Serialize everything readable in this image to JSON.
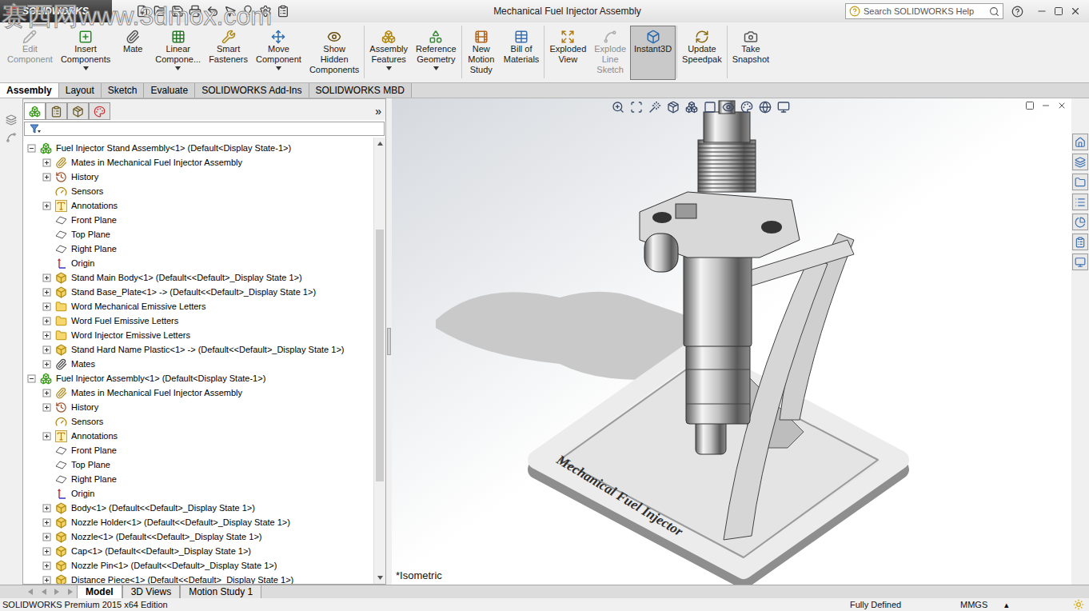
{
  "window": {
    "title": "Mechanical Fuel Injector Assembly",
    "logo": "SOLIDWORKS",
    "watermark": "赛西网www.3dmox.com"
  },
  "search": {
    "placeholder": "Search SOLIDWORKS Help"
  },
  "ribbon": {
    "buttons": [
      {
        "lines": [
          "Edit",
          "Component"
        ],
        "disabled": true,
        "selected": false,
        "dropdown": false
      },
      {
        "lines": [
          "Insert",
          "Components"
        ],
        "disabled": false,
        "selected": false,
        "dropdown": true
      },
      {
        "lines": [
          "Mate"
        ],
        "disabled": false,
        "selected": false,
        "dropdown": false
      },
      {
        "lines": [
          "Linear",
          "Compone..."
        ],
        "disabled": false,
        "selected": false,
        "dropdown": true
      },
      {
        "lines": [
          "Smart",
          "Fasteners"
        ],
        "disabled": false,
        "selected": false,
        "dropdown": false
      },
      {
        "lines": [
          "Move",
          "Component"
        ],
        "disabled": false,
        "selected": false,
        "dropdown": true
      },
      {
        "lines": [
          "Show",
          "Hidden",
          "Components"
        ],
        "disabled": false,
        "selected": false,
        "dropdown": false
      },
      {
        "lines": [
          "Assembly",
          "Features"
        ],
        "disabled": false,
        "selected": false,
        "dropdown": true
      },
      {
        "lines": [
          "Reference",
          "Geometry"
        ],
        "disabled": false,
        "selected": false,
        "dropdown": true
      },
      {
        "lines": [
          "New",
          "Motion",
          "Study"
        ],
        "disabled": false,
        "selected": false,
        "dropdown": false
      },
      {
        "lines": [
          "Bill of",
          "Materials"
        ],
        "disabled": false,
        "selected": false,
        "dropdown": false
      },
      {
        "lines": [
          "Exploded",
          "View"
        ],
        "disabled": false,
        "selected": false,
        "dropdown": false
      },
      {
        "lines": [
          "Explode",
          "Line",
          "Sketch"
        ],
        "disabled": true,
        "selected": false,
        "dropdown": false
      },
      {
        "lines": [
          "Instant3D"
        ],
        "disabled": false,
        "selected": true,
        "dropdown": false
      },
      {
        "lines": [
          "Update",
          "Speedpak"
        ],
        "disabled": false,
        "selected": false,
        "dropdown": false
      },
      {
        "lines": [
          "Take",
          "Snapshot"
        ],
        "disabled": false,
        "selected": false,
        "dropdown": false
      }
    ]
  },
  "command_tabs": [
    {
      "label": "Assembly",
      "selected": true
    },
    {
      "label": "Layout",
      "selected": false
    },
    {
      "label": "Sketch",
      "selected": false
    },
    {
      "label": "Evaluate",
      "selected": false
    },
    {
      "label": "SOLIDWORKS Add-Ins",
      "selected": false
    },
    {
      "label": "SOLIDWORKS MBD",
      "selected": false
    }
  ],
  "panel": {
    "expand": "»"
  },
  "feature_tree": {
    "items": [
      {
        "label": "Fuel Injector Stand Assembly<1> (Default<Display State-1>)",
        "level": 0,
        "kind": "assembly",
        "expandable": true,
        "expanded": true
      },
      {
        "label": "Mates in Mechanical Fuel Injector Assembly",
        "level": 1,
        "kind": "mates",
        "expandable": true,
        "expanded": false
      },
      {
        "label": "History",
        "level": 1,
        "kind": "history",
        "expandable": true,
        "expanded": false
      },
      {
        "label": "Sensors",
        "level": 1,
        "kind": "sensors",
        "expandable": false,
        "expanded": false
      },
      {
        "label": "Annotations",
        "level": 1,
        "kind": "annotations",
        "expandable": true,
        "expanded": false
      },
      {
        "label": "Front Plane",
        "level": 1,
        "kind": "plane",
        "expandable": false,
        "expanded": false
      },
      {
        "label": "Top Plane",
        "level": 1,
        "kind": "plane",
        "expandable": false,
        "expanded": false
      },
      {
        "label": "Right Plane",
        "level": 1,
        "kind": "plane",
        "expandable": false,
        "expanded": false
      },
      {
        "label": "Origin",
        "level": 1,
        "kind": "origin",
        "expandable": false,
        "expanded": false
      },
      {
        "label": "Stand Main Body<1> (Default<<Default>_Display State 1>)",
        "level": 1,
        "kind": "part",
        "expandable": true,
        "expanded": false
      },
      {
        "label": "Stand Base_Plate<1> -> (Default<<Default>_Display State 1>)",
        "level": 1,
        "kind": "part",
        "expandable": true,
        "expanded": false
      },
      {
        "label": "Word Mechanical Emissive Letters",
        "level": 1,
        "kind": "folder",
        "expandable": true,
        "expanded": false
      },
      {
        "label": "Word Fuel Emissive Letters",
        "level": 1,
        "kind": "folder",
        "expandable": true,
        "expanded": false
      },
      {
        "label": "Word Injector Emissive Letters",
        "level": 1,
        "kind": "folder",
        "expandable": true,
        "expanded": false
      },
      {
        "label": "Stand Hard Name Plastic<1> -> (Default<<Default>_Display State 1>)",
        "level": 1,
        "kind": "part",
        "expandable": true,
        "expanded": false
      },
      {
        "label": "Mates",
        "level": 1,
        "kind": "mategroup",
        "expandable": true,
        "expanded": false
      },
      {
        "label": "Fuel Injector Assembly<1> (Default<Display State-1>)",
        "level": 0,
        "kind": "assembly",
        "expandable": true,
        "expanded": true
      },
      {
        "label": "Mates in Mechanical Fuel Injector Assembly",
        "level": 1,
        "kind": "mates",
        "expandable": true,
        "expanded": false
      },
      {
        "label": "History",
        "level": 1,
        "kind": "history",
        "expandable": true,
        "expanded": false
      },
      {
        "label": "Sensors",
        "level": 1,
        "kind": "sensors",
        "expandable": false,
        "expanded": false
      },
      {
        "label": "Annotations",
        "level": 1,
        "kind": "annotations",
        "expandable": true,
        "expanded": false
      },
      {
        "label": "Front Plane",
        "level": 1,
        "kind": "plane",
        "expandable": false,
        "expanded": false
      },
      {
        "label": "Top Plane",
        "level": 1,
        "kind": "plane",
        "expandable": false,
        "expanded": false
      },
      {
        "label": "Right Plane",
        "level": 1,
        "kind": "plane",
        "expandable": false,
        "expanded": false
      },
      {
        "label": "Origin",
        "level": 1,
        "kind": "origin",
        "expandable": false,
        "expanded": false
      },
      {
        "label": "Body<1> (Default<<Default>_Display State 1>)",
        "level": 1,
        "kind": "part",
        "expandable": true,
        "expanded": false
      },
      {
        "label": "Nozzle Holder<1> (Default<<Default>_Display State 1>)",
        "level": 1,
        "kind": "part",
        "expandable": true,
        "expanded": false
      },
      {
        "label": "Nozzle<1> (Default<<Default>_Display State 1>)",
        "level": 1,
        "kind": "part",
        "expandable": true,
        "expanded": false
      },
      {
        "label": "Cap<1> (Default<<Default>_Display State 1>)",
        "level": 1,
        "kind": "part",
        "expandable": true,
        "expanded": false
      },
      {
        "label": "Nozzle Pin<1> (Default<<Default>_Display State 1>)",
        "level": 1,
        "kind": "part",
        "expandable": true,
        "expanded": false
      },
      {
        "label": "Distance Piece<1> (Default<<Default>_Display State 1>)",
        "level": 1,
        "kind": "part",
        "expandable": true,
        "expanded": false
      }
    ]
  },
  "viewport": {
    "view_label": "*Isometric",
    "model_text": "Mechanical Fuel Injector"
  },
  "bottom_tabs": [
    {
      "label": "Model",
      "selected": true
    },
    {
      "label": "3D Views",
      "selected": false
    },
    {
      "label": "Motion Study 1",
      "selected": false
    }
  ],
  "status_bar": {
    "edition": "SOLIDWORKS Premium 2015 x64 Edition",
    "state": "Fully Defined",
    "units": "MMGS",
    "units_menu": "▴"
  }
}
